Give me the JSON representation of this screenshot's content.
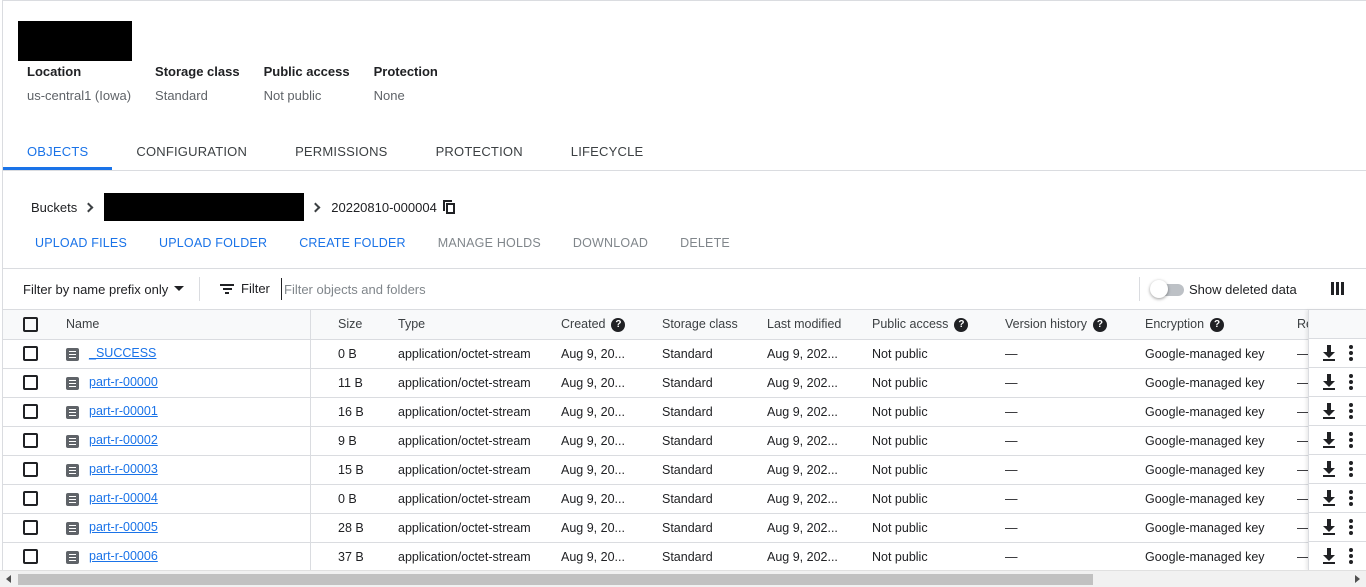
{
  "header": {
    "meta": [
      {
        "key": "Location",
        "value": "us-central1 (Iowa)"
      },
      {
        "key": "Storage class",
        "value": "Standard"
      },
      {
        "key": "Public access",
        "value": "Not public"
      },
      {
        "key": "Protection",
        "value": "None"
      }
    ]
  },
  "tabs": [
    "OBJECTS",
    "CONFIGURATION",
    "PERMISSIONS",
    "PROTECTION",
    "LIFECYCLE"
  ],
  "breadcrumb": {
    "root": "Buckets",
    "current": "20220810-000004"
  },
  "actions": [
    "UPLOAD FILES",
    "UPLOAD FOLDER",
    "CREATE FOLDER",
    "MANAGE HOLDS",
    "DOWNLOAD",
    "DELETE"
  ],
  "filterbar": {
    "prefix_label": "Filter by name prefix only",
    "filter_label": "Filter",
    "placeholder": "Filter objects and folders",
    "toggle_label": "Show deleted data"
  },
  "table": {
    "columns": [
      "Name",
      "Size",
      "Type",
      "Created",
      "Storage class",
      "Last modified",
      "Public access",
      "Version history",
      "Encryption",
      "Re"
    ],
    "rows": [
      [
        "_SUCCESS",
        "0 B",
        "application/octet-stream",
        "Aug 9, 20...",
        "Standard",
        "Aug 9, 202...",
        "Not public",
        "—",
        "Google-managed key",
        "—"
      ],
      [
        "part-r-00000",
        "11 B",
        "application/octet-stream",
        "Aug 9, 20...",
        "Standard",
        "Aug 9, 202...",
        "Not public",
        "—",
        "Google-managed key",
        "—"
      ],
      [
        "part-r-00001",
        "16 B",
        "application/octet-stream",
        "Aug 9, 20...",
        "Standard",
        "Aug 9, 202...",
        "Not public",
        "—",
        "Google-managed key",
        "—"
      ],
      [
        "part-r-00002",
        "9 B",
        "application/octet-stream",
        "Aug 9, 20...",
        "Standard",
        "Aug 9, 202...",
        "Not public",
        "—",
        "Google-managed key",
        "—"
      ],
      [
        "part-r-00003",
        "15 B",
        "application/octet-stream",
        "Aug 9, 20...",
        "Standard",
        "Aug 9, 202...",
        "Not public",
        "—",
        "Google-managed key",
        "—"
      ],
      [
        "part-r-00004",
        "0 B",
        "application/octet-stream",
        "Aug 9, 20...",
        "Standard",
        "Aug 9, 202...",
        "Not public",
        "—",
        "Google-managed key",
        "—"
      ],
      [
        "part-r-00005",
        "28 B",
        "application/octet-stream",
        "Aug 9, 20...",
        "Standard",
        "Aug 9, 202...",
        "Not public",
        "—",
        "Google-managed key",
        "—"
      ],
      [
        "part-r-00006",
        "37 B",
        "application/octet-stream",
        "Aug 9, 20...",
        "Standard",
        "Aug 9, 202...",
        "Not public",
        "—",
        "Google-managed key",
        "—"
      ]
    ]
  },
  "colors": {
    "accent": "#1a73e8",
    "muted": "#80868b"
  },
  "icons": {
    "help": "help-icon",
    "file": "file-icon",
    "download": "download-icon",
    "more": "more-vert-icon",
    "columns": "columns-icon",
    "copy": "copy-icon",
    "filter": "filter-icon"
  }
}
